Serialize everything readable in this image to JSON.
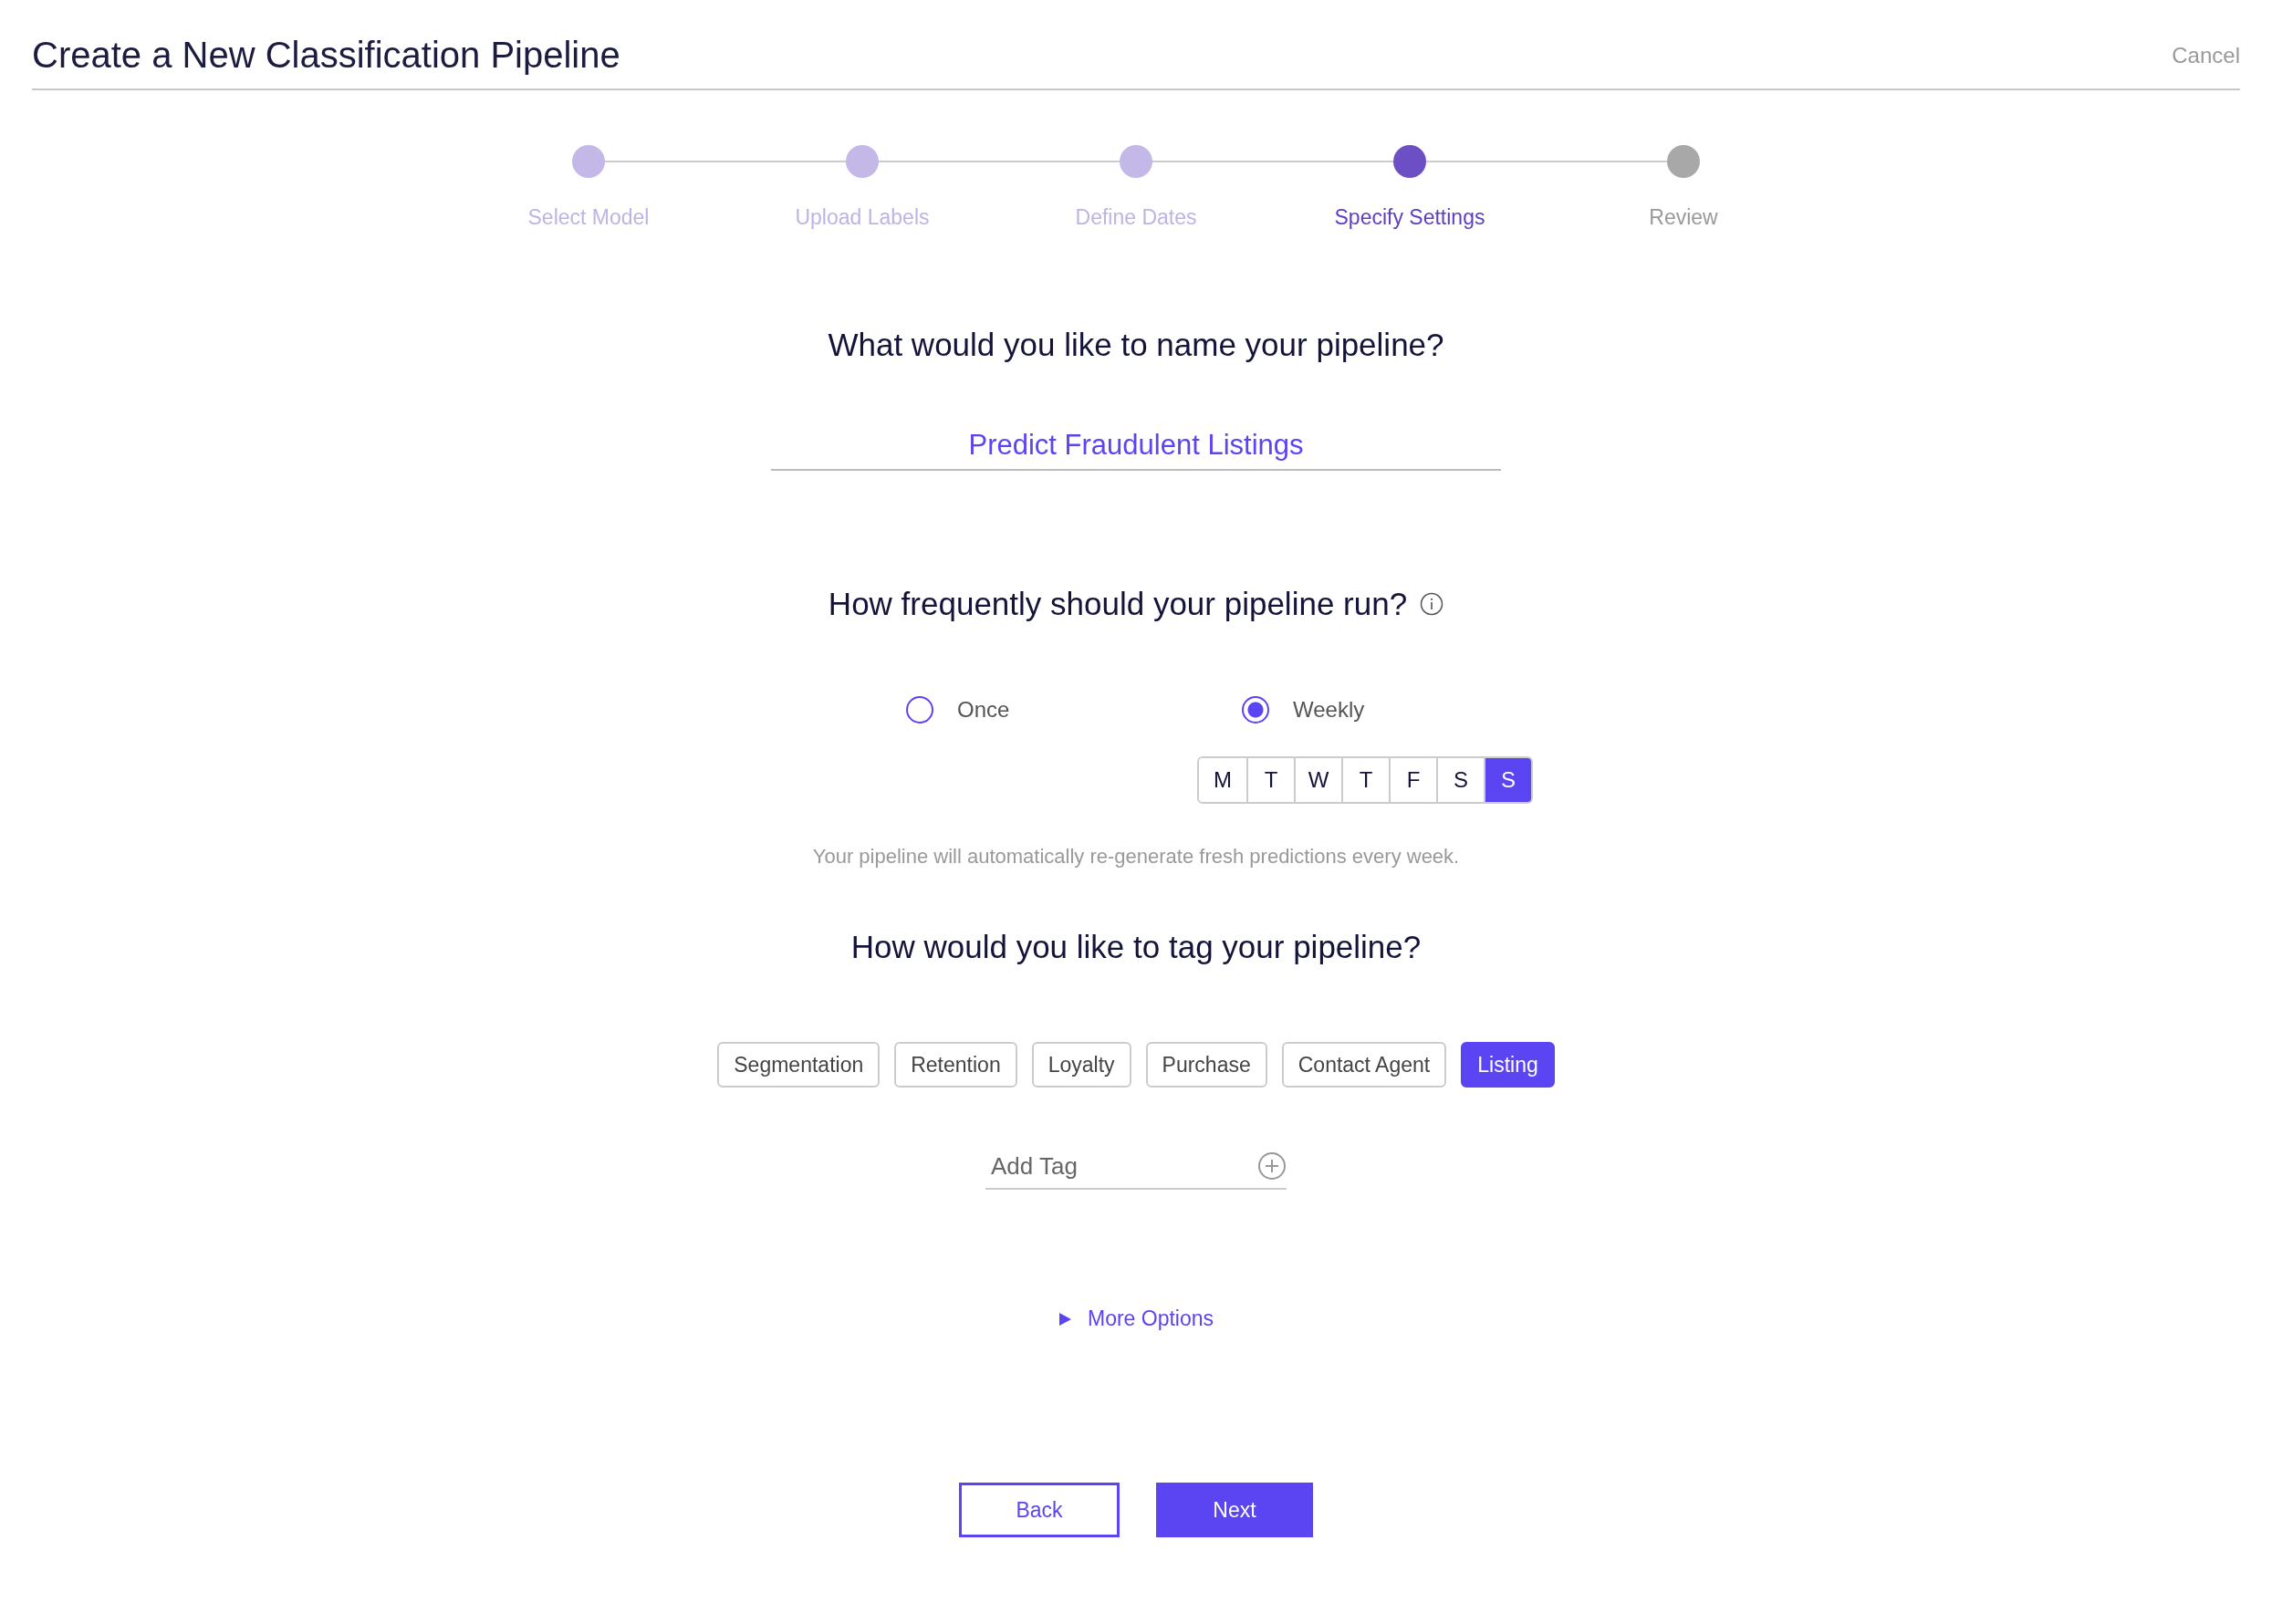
{
  "header": {
    "title": "Create a New Classification Pipeline",
    "cancel": "Cancel"
  },
  "steps": [
    {
      "label": "Select Model",
      "completed": true,
      "selected": false
    },
    {
      "label": "Upload Labels",
      "completed": true,
      "selected": false
    },
    {
      "label": "Define Dates",
      "completed": true,
      "selected": false
    },
    {
      "label": "Specify Settings",
      "completed": false,
      "selected": true
    },
    {
      "label": "Review",
      "completed": false,
      "selected": false
    }
  ],
  "name_section": {
    "question": "What would you like to name your pipeline?",
    "value": "Predict Fraudulent Listings"
  },
  "frequency_section": {
    "question": "How frequently should your pipeline run?",
    "options": [
      {
        "label": "Once",
        "selected": false
      },
      {
        "label": "Weekly",
        "selected": true
      }
    ],
    "days": [
      {
        "label": "M",
        "selected": false
      },
      {
        "label": "T",
        "selected": false
      },
      {
        "label": "W",
        "selected": false
      },
      {
        "label": "T",
        "selected": false
      },
      {
        "label": "F",
        "selected": false
      },
      {
        "label": "S",
        "selected": false
      },
      {
        "label": "S",
        "selected": true
      }
    ],
    "note": "Your pipeline will automatically re-generate fresh predictions every week."
  },
  "tag_section": {
    "question": "How would you like to tag your pipeline?",
    "tags": [
      {
        "label": "Segmentation",
        "selected": false
      },
      {
        "label": "Retention",
        "selected": false
      },
      {
        "label": "Loyalty",
        "selected": false
      },
      {
        "label": "Purchase",
        "selected": false
      },
      {
        "label": "Contact Agent",
        "selected": false
      },
      {
        "label": "Listing",
        "selected": true
      }
    ],
    "add_tag": {
      "placeholder": "Add Tag"
    }
  },
  "more_options": {
    "label": "More Options",
    "expanded": false
  },
  "buttons": [
    {
      "label": "Back",
      "kind": "secondary"
    },
    {
      "label": "Next",
      "kind": "primary"
    }
  ]
}
